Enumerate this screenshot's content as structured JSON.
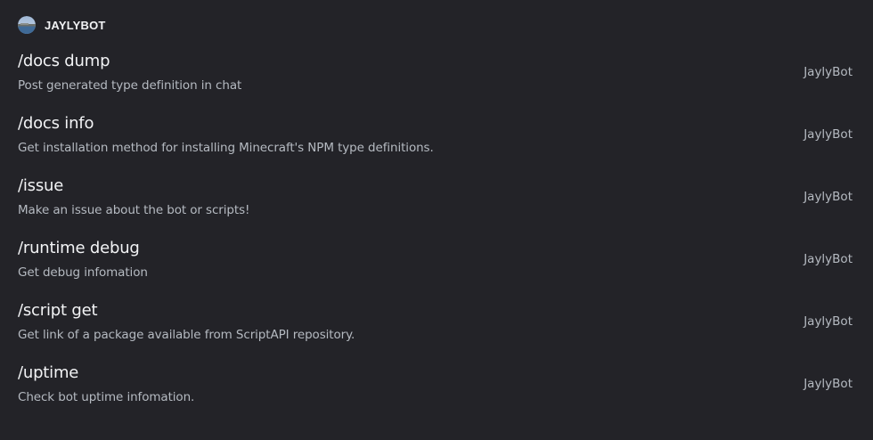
{
  "section": {
    "bot_name": "JAYLYBOT",
    "avatar_icon": "bot-avatar-icon"
  },
  "commands": [
    {
      "name": "/docs dump",
      "description": "Post generated type definition in chat",
      "source": "JaylyBot"
    },
    {
      "name": "/docs info",
      "description": "Get installation method for installing Minecraft's NPM type definitions.",
      "source": "JaylyBot"
    },
    {
      "name": "/issue",
      "description": "Make an issue about the bot or scripts!",
      "source": "JaylyBot"
    },
    {
      "name": "/runtime debug",
      "description": "Get debug infomation",
      "source": "JaylyBot"
    },
    {
      "name": "/script get",
      "description": "Get link of a package available from ScriptAPI repository.",
      "source": "JaylyBot"
    },
    {
      "name": "/uptime",
      "description": "Check bot uptime infomation.",
      "source": "JaylyBot"
    }
  ],
  "colors": {
    "background": "#232328",
    "text_primary": "#f2f3f5",
    "text_secondary": "#b5bac1"
  }
}
